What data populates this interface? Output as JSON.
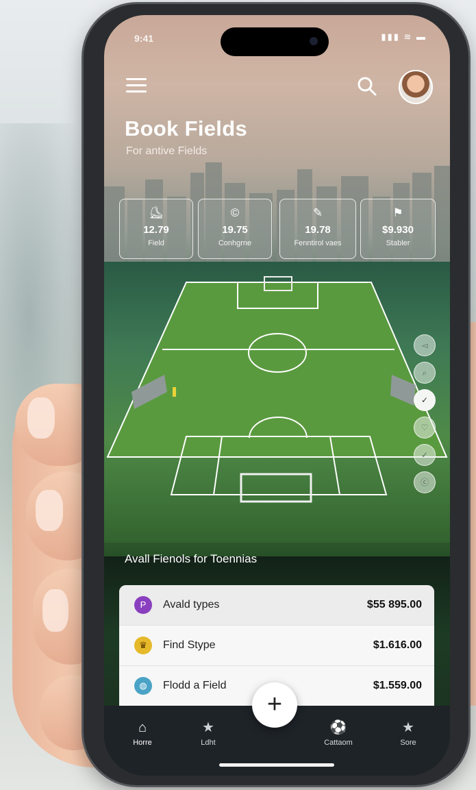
{
  "status_bar": {
    "time": "9:41",
    "icons": "▮▮▮ ≋ ▬"
  },
  "header": {
    "title": "Book Fields",
    "subtitle": "For antive Fields"
  },
  "stats": [
    {
      "icon": "shoe-icon",
      "glyph": "⛸",
      "value": "12.79",
      "label": "Field"
    },
    {
      "icon": "coin-icon",
      "glyph": "©",
      "value": "19.75",
      "label": "Conhgrne"
    },
    {
      "icon": "boot-icon",
      "glyph": "✎",
      "value": "19.78",
      "label": "Fenntirol vaes"
    },
    {
      "icon": "flag-icon",
      "glyph": "⚑",
      "value": "$9.930",
      "label": "Stabler"
    }
  ],
  "side_dots": [
    "◅",
    "⌕",
    "✓",
    "♡",
    "✓",
    "ⓒ"
  ],
  "section": {
    "title": "Avall Fienols for Toennias"
  },
  "fields": [
    {
      "icon": "p-badge-icon",
      "glyph": "P",
      "color": "#8a3fbf",
      "name": "Avald types",
      "price": "$55 895.00"
    },
    {
      "icon": "trophy-icon",
      "glyph": "♛",
      "color": "#e6b92a",
      "name": "Find Stype",
      "price": "$1.616.00"
    },
    {
      "icon": "globe-icon",
      "glyph": "◍",
      "color": "#4aa3c6",
      "name": "Flodd a Field",
      "price": "$1.559.00"
    }
  ],
  "tabs": [
    {
      "icon": "home-icon",
      "glyph": "⌂",
      "label": "Horre"
    },
    {
      "icon": "star-icon",
      "glyph": "★",
      "label": "Ldht"
    },
    {
      "icon": "ball-icon",
      "glyph": "⚽",
      "label": "Cattaom"
    },
    {
      "icon": "star-icon",
      "glyph": "★",
      "label": "Sore"
    }
  ],
  "fab": {
    "label": "+"
  },
  "colors": {
    "tabbar": "#1e2328",
    "pitch": "#4f8a47",
    "card": "#f7f7f7"
  }
}
